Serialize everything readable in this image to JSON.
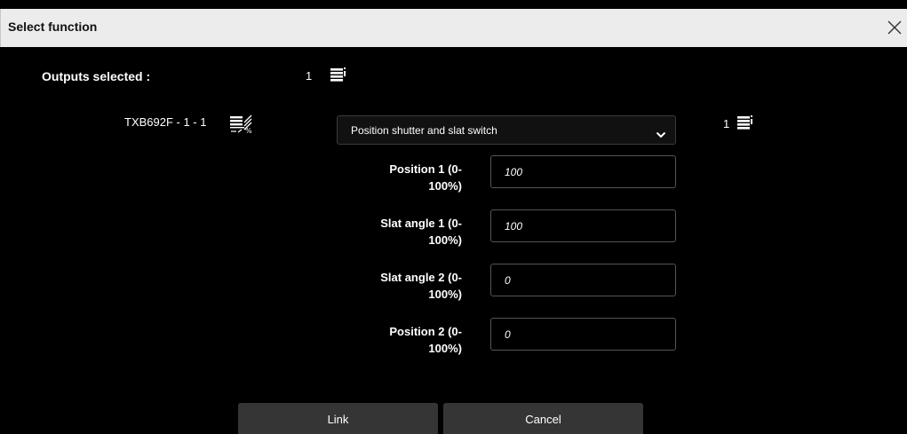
{
  "dialog": {
    "title": "Select function",
    "close_icon": "close-x-icon"
  },
  "outputs": {
    "label": "Outputs selected :",
    "count": "1",
    "icon": "blinds-icon"
  },
  "device": {
    "label": "TXB692F - 1 - 1",
    "icon": "shutter-slat-percent-icon"
  },
  "function_select": {
    "selected": "Position shutter and slat switch",
    "icon": "chevron-down-icon"
  },
  "right_output": {
    "count": "1",
    "icon": "blinds-icon"
  },
  "fields": [
    {
      "label_line1": "Position 1 (0-",
      "label_line2": "100%)",
      "value": "100"
    },
    {
      "label_line1": "Slat angle 1 (0-",
      "label_line2": "100%)",
      "value": "100"
    },
    {
      "label_line1": "Slat angle 2 (0-",
      "label_line2": "100%)",
      "value": "0"
    },
    {
      "label_line1": "Position 2 (0-",
      "label_line2": "100%)",
      "value": "0"
    }
  ],
  "buttons": {
    "link": "Link",
    "cancel": "Cancel"
  },
  "colors": {
    "background": "#000000",
    "titlebar": "#ececec",
    "button": "#353535",
    "input_border": "#555555"
  }
}
